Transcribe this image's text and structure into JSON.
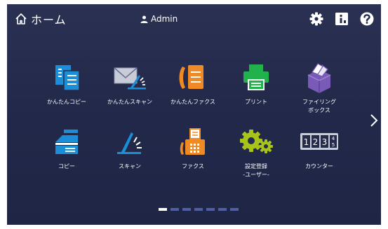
{
  "header": {
    "title": "ホーム",
    "user": "Admin",
    "icons": [
      "home-icon",
      "user-icon",
      "settings-icon",
      "info-icon",
      "help-icon"
    ]
  },
  "tiles": [
    {
      "label": "かんたんコピー",
      "icon": "easy-copy-icon"
    },
    {
      "label": "かんたんスキャン",
      "icon": "easy-scan-icon"
    },
    {
      "label": "かんたんファクス",
      "icon": "easy-fax-icon"
    },
    {
      "label": "プリント",
      "icon": "print-icon"
    },
    {
      "label": "ファイリング\nボックス",
      "icon": "filing-box-icon"
    },
    {
      "label": "コピー",
      "icon": "copy-icon"
    },
    {
      "label": "スキャン",
      "icon": "scan-icon"
    },
    {
      "label": "ファクス",
      "icon": "fax-icon"
    },
    {
      "label": "設定登録\n-ユーザー-",
      "icon": "settings-registration-icon"
    },
    {
      "label": "カウンター",
      "icon": "counter-icon"
    }
  ],
  "pager": {
    "pages": 7,
    "active": 1
  },
  "colors": {
    "background": "#252b4b",
    "blue": "#1a8fd8",
    "orange": "#f08a24",
    "green": "#22b24c",
    "purple": "#7a5ab8",
    "yellowgreen": "#a8c41a"
  }
}
